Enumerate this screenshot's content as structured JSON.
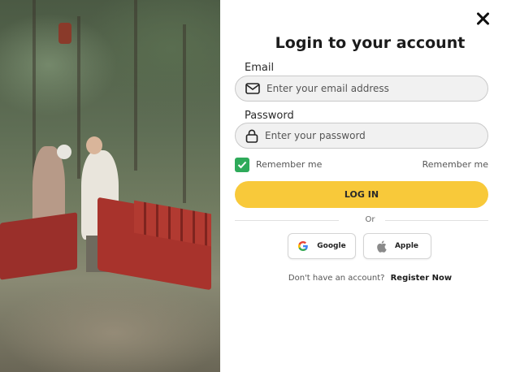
{
  "photo": {
    "alt_name": "elderly-couple-photo"
  },
  "form": {
    "title": "Login to your account",
    "email": {
      "label": "Email",
      "placeholder": "Enter your email address"
    },
    "password": {
      "label": "Password",
      "placeholder": "Enter your password"
    },
    "remember_label": "Remember me",
    "remember_right_label": "Remember me",
    "remember_checked": true,
    "login_label": "LOG IN",
    "divider_text": "Or",
    "social": [
      {
        "label": "Google",
        "icon": "google-icon"
      },
      {
        "label": "Apple",
        "icon": "apple-icon"
      }
    ],
    "register_prompt": "Don't have an account?",
    "register_link": "Register Now"
  },
  "colors": {
    "accent_yellow": "#f8c93a",
    "checkbox_green": "#2eaa5a",
    "field_bg": "#f1f1f1"
  }
}
